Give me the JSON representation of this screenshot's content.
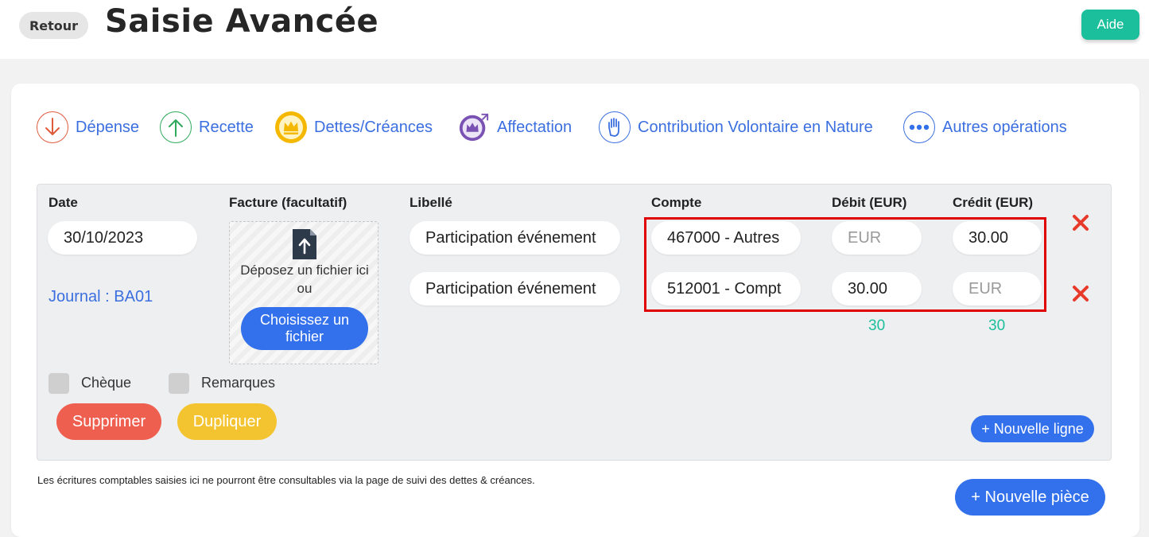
{
  "header": {
    "back_label": "Retour",
    "title": "Saisie Avancée",
    "help_label": "Aide"
  },
  "operation_types": [
    {
      "label": "Dépense",
      "icon": "arrow-down-icon",
      "color": "#e05a3c"
    },
    {
      "label": "Recette",
      "icon": "arrow-up-icon",
      "color": "#2eaa5b"
    },
    {
      "label": "Dettes/Créances",
      "icon": "crown-icon",
      "color": "#f5b800"
    },
    {
      "label": "Affectation",
      "icon": "crown-transfer-icon",
      "color": "#7a52b3"
    },
    {
      "label": "Contribution Volontaire en Nature",
      "icon": "hand-icon",
      "color": "#3b6fe0"
    },
    {
      "label": "Autres opérations",
      "icon": "more-dots-icon",
      "color": "#3b6fe0"
    }
  ],
  "entry": {
    "columns": {
      "date": "Date",
      "invoice": "Facture (facultatif)",
      "label": "Libellé",
      "account": "Compte",
      "debit": "Débit (EUR)",
      "credit": "Crédit (EUR)"
    },
    "date_value": "30/10/2023",
    "journal": "Journal : BA01",
    "dropzone": {
      "text": "Déposez un fichier ici",
      "or": "ou",
      "button_line1": "Choisissez un",
      "button_line2": "fichier"
    },
    "lines": [
      {
        "label": "Participation événement",
        "account": "467000 - Autres",
        "debit": "",
        "credit": "30.00"
      },
      {
        "label": "Participation événement",
        "account": "512001 - Compt",
        "debit": "30.00",
        "credit": ""
      }
    ],
    "amount_placeholder": "EUR",
    "totals": {
      "debit": "30",
      "credit": "30"
    },
    "options": {
      "cheque": "Chèque",
      "remarks": "Remarques"
    },
    "actions": {
      "delete": "Supprimer",
      "duplicate": "Dupliquer",
      "new_line": "+ Nouvelle ligne"
    }
  },
  "footer": {
    "note": "Les écritures comptables saisies ici ne pourront être consultables via la page de suivi des dettes & créances.",
    "new_piece": "+ Nouvelle pièce"
  },
  "colors": {
    "accent_blue": "#3370eb",
    "teal": "#1bbf9b",
    "delete_red": "#ef5f50",
    "duplicate_yellow": "#f4c430",
    "highlight_red": "#e00000"
  }
}
